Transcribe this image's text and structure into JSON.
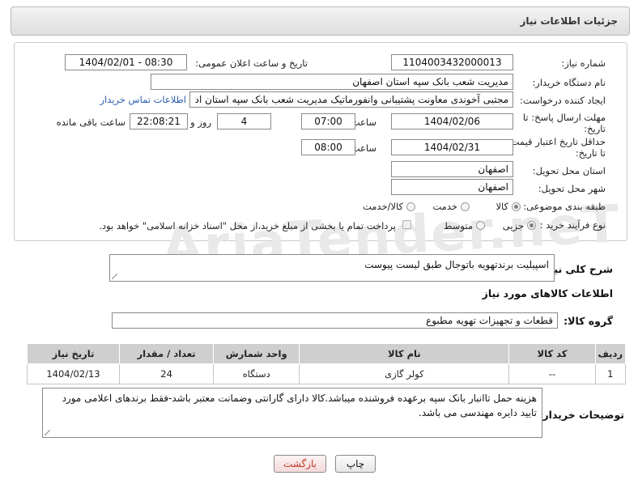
{
  "header": {
    "title": "جزئیات اطلاعات نیاز"
  },
  "watermark": "AriaTender.neT",
  "form": {
    "need_number": {
      "label": "شماره نیاز:",
      "value": "1104003432000013"
    },
    "announce_datetime": {
      "label": "تاریخ و ساعت اعلان عمومی:",
      "value": "1404/02/01 - 08:30"
    },
    "buyer_org": {
      "label": "نام دستگاه خریدار:",
      "value": "مدیریت شعب بانک سپه استان اصفهان"
    },
    "requester": {
      "label": "ایجاد کننده درخواست:",
      "value": "مجتبی آخوندی معاونت پشتیبانی وانفورماتیک مدیریت شعب بانک سپه استان اد",
      "contact_link": "اطلاعات تماس خریدار"
    },
    "reply_deadline": {
      "label": "مهلت ارسال پاسخ: تا تاریخ:",
      "date": "1404/02/06",
      "time_label": "ساعت",
      "time": "07:00",
      "days": "4",
      "days_label": "روز و",
      "remaining": "22:08:21",
      "remaining_label": "ساعت باقی مانده"
    },
    "price_validity": {
      "label": "حداقل تاریخ اعتبار قیمت: تا تاریخ:",
      "date": "1404/02/31",
      "time_label": "ساعت",
      "time": "08:00"
    },
    "delivery_province": {
      "label": "استان محل تحویل:",
      "value": "اصفهان"
    },
    "delivery_city": {
      "label": "شهر محل تحویل:",
      "value": "اصفهان"
    },
    "category": {
      "label": "طبقه بندی موضوعی:",
      "options": [
        "کالا",
        "خدمت",
        "کالا/خدمت"
      ],
      "selected": "کالا"
    },
    "process": {
      "label": "نوع فرآیند خرید :",
      "options": [
        "جزیی",
        "متوسط"
      ],
      "selected": "جزیی",
      "note": "پرداخت تمام یا بخشی از مبلغ خرید،از محل \"اسناد خزانه اسلامی\" خواهد بود."
    }
  },
  "summary": {
    "label": "شرح کلی نیاز:",
    "value": "اسپیلیت برندتهویه باتوجال طبق لیست پیوست"
  },
  "goods": {
    "title": "اطلاعات کالاهای مورد نیاز",
    "group_label": "گروه کالا:",
    "group_value": "قطعات و تجهیزات تهویه مطبوع",
    "columns": [
      "ردیف",
      "کد کالا",
      "نام کالا",
      "واحد شمارش",
      "تعداد / مقدار",
      "تاریخ نیاز"
    ],
    "rows": [
      [
        "1",
        "--",
        "کولر گازی",
        "دستگاه",
        "24",
        "1404/02/13"
      ]
    ]
  },
  "buyer_notes": {
    "label": "توضیحات خریدار:",
    "value": "هزینه حمل تاانبار بانک سپه برعهده فروشنده میباشد.کالا دارای گارانتی وضمانت معتبر باشد-فقط برندهای اعلامی مورد تایید دایره مهندسی می باشد."
  },
  "buttons": {
    "print": "چاپ",
    "back": "بازگشت"
  }
}
